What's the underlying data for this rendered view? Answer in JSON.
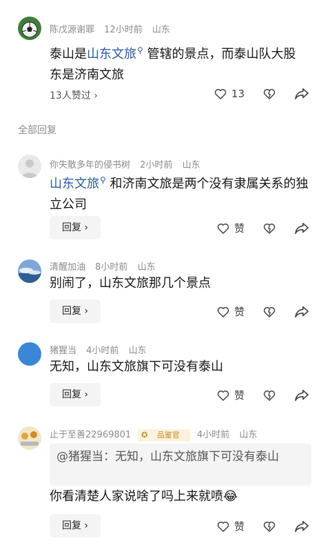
{
  "colors": {
    "link": "#2c5aa0",
    "meta": "#8a8a8a",
    "reply_bg": "#f4f4f4",
    "badge": "#c58a1e"
  },
  "top_comment": {
    "user": "陈戊源谢罪",
    "time": "12小时前",
    "location": "山东",
    "text_before": "泰山是",
    "link_text": "山东文旅",
    "text_after": "管辖的景点，而泰山队大股东是济南文旅",
    "likes_summary": "13人赞过",
    "like_count": "13"
  },
  "section_title": "全部回复",
  "replies": [
    {
      "user": "你失散多年的侵书树",
      "time": "2小时前",
      "location": "山东",
      "link_text": "山东文旅",
      "text_after": "和济南文旅是两个没有隶属关系的独立公司",
      "reply_label": "回复",
      "like_label": "赞"
    },
    {
      "user": "清醒加油",
      "time": "8小时前",
      "location": "山东",
      "text": "别闹了，山东文旅那几个景点",
      "reply_label": "回复",
      "like_label": "赞"
    },
    {
      "user": "猪猩当",
      "time": "4小时前",
      "location": "山东",
      "text": "无知，山东文旅旗下可没有泰山",
      "reply_label": "回复",
      "like_label": "赞"
    },
    {
      "user": "止于至善22969801",
      "badge": "品鉴官",
      "time": "4小时前",
      "location": "山东",
      "quote": "@猪猩当：无知，山东文旅旗下可没有泰山",
      "text": "你看清楚人家说啥了吗上来就喷",
      "reply_label": "回复",
      "like_label": "赞"
    }
  ]
}
